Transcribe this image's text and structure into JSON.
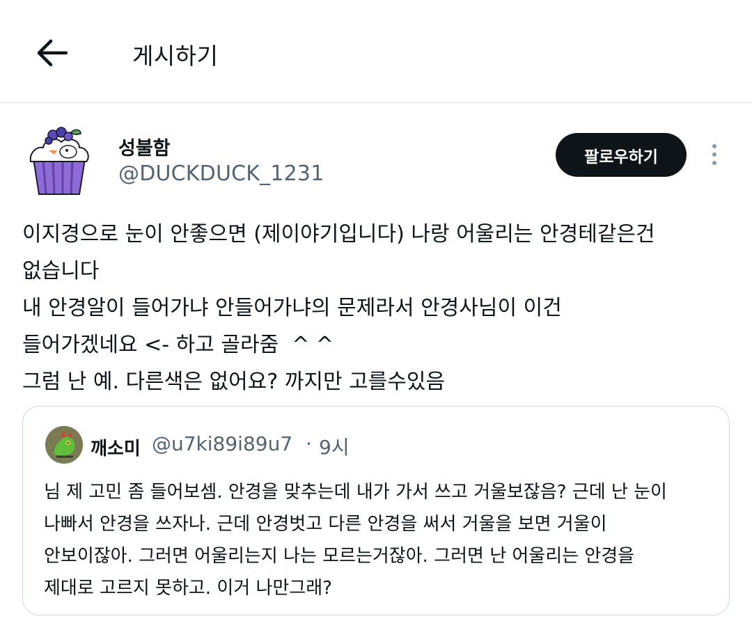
{
  "header": {
    "title": "게시하기",
    "back_icon": "arrow-left-icon"
  },
  "post": {
    "author": {
      "name": "성불함",
      "handle": "@DUCKDUCK_1231",
      "avatar_icon": "blueberry-cupcake-avatar"
    },
    "follow_label": "팔로우하기",
    "more_icon": "more-vertical-icon",
    "text": "이지경으로 눈이 안좋으면 (제이야기입니다) 나랑 어울리는 안경테같은건\n없습니다\n내 안경알이 들어가냐 안들어가냐의 문제라서 안경사님이 이건\n들어가겠네요 <- 하고 골라줌  ^ ^\n그럼 난 예. 다른색은 없어요? 까지만 고를수있음"
  },
  "quote": {
    "name": "깨소미",
    "handle": "@u7ki89i89u7",
    "separator": "·",
    "time": "9시",
    "text": "님 제 고민 좀 들어보셈. 안경을 맞추는데 내가 가서 쓰고 거울보잖음? 근데 난 눈이\n나빠서 안경을 쓰자나. 근데 안경벗고 다른 안경을 써서 거울을 보면 거울이\n안보이잖아. 그러면 어울리는지 나는 모르는거잖아. 그러면 난 어울리는 안경을\n제대로 고르지 못하고. 이거 나만그래?"
  },
  "colors": {
    "text_primary": "#0f1419",
    "text_secondary": "#536471",
    "follow_bg": "#0f1419",
    "border": "#cfd9de"
  }
}
